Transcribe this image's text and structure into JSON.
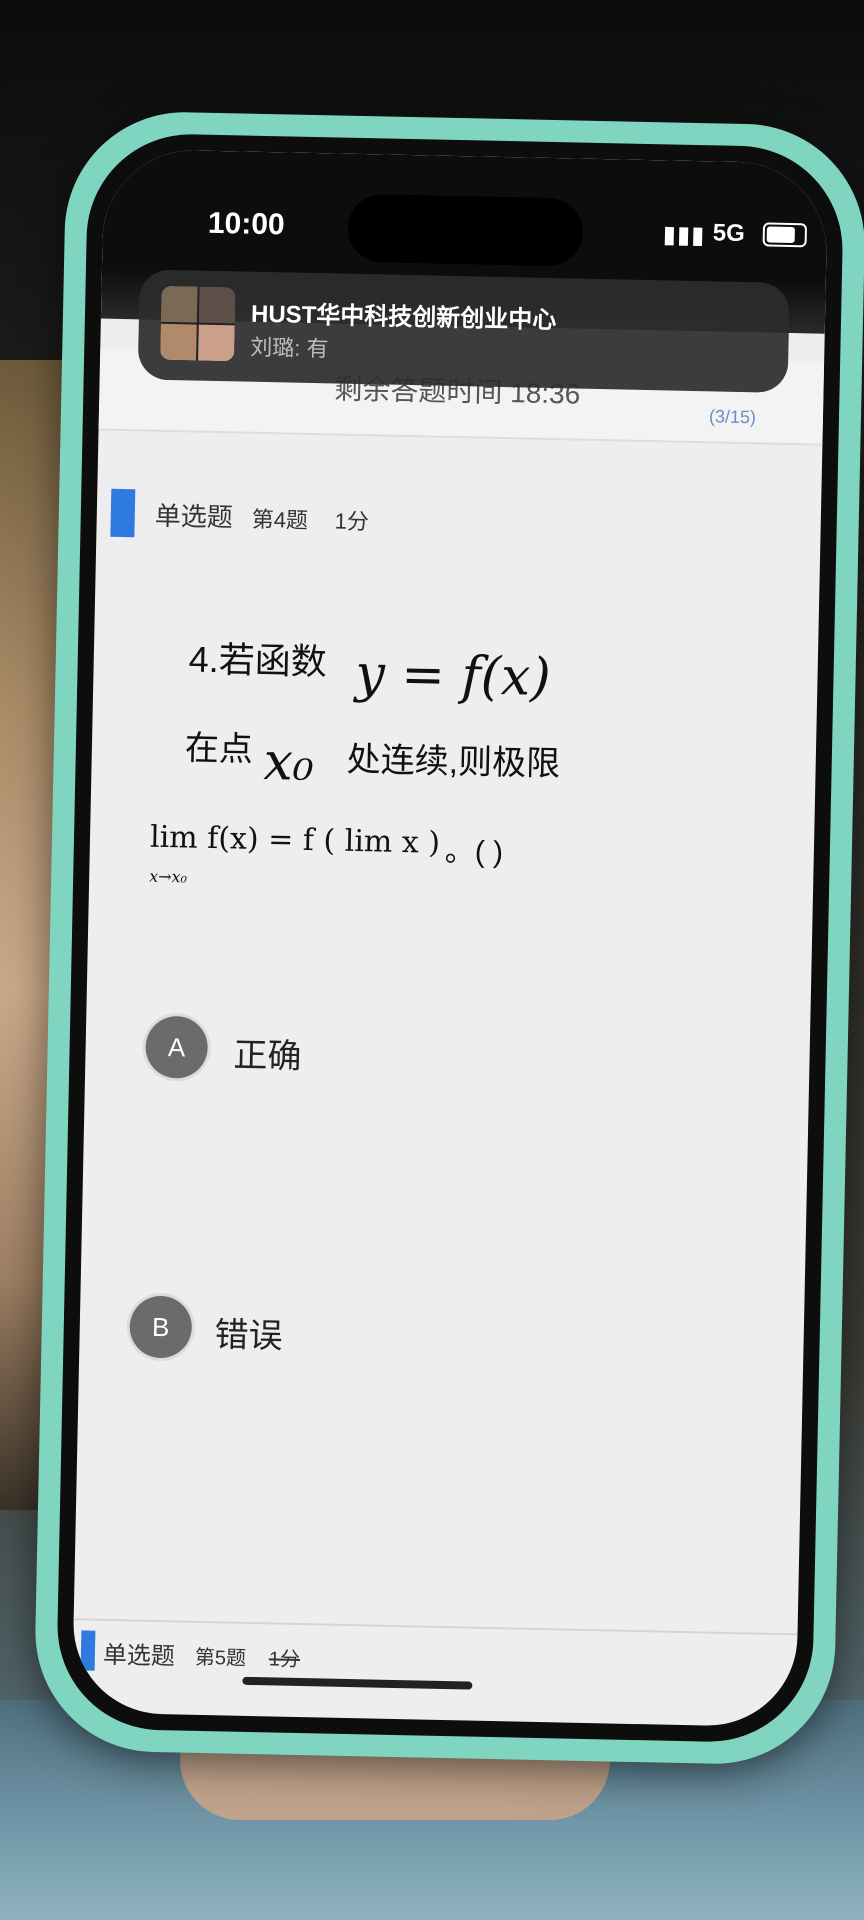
{
  "status_bar": {
    "time": "10:00",
    "network": "5G"
  },
  "notification": {
    "title": "HUST华中科技创新创业中心",
    "message": "刘璐: 有"
  },
  "exam": {
    "timer": "剩余答题时间 18:36",
    "progress": "(3/15)"
  },
  "question": {
    "type": "单选题",
    "number_label": "第4题",
    "score": "1分",
    "text_part1": "4.若函数",
    "math_y": "y = f(x)",
    "text_part2": "在点",
    "math_x0": "x₀",
    "text_part3": "处连续,则极限",
    "math_limit": "lim f(x) = f ( lim x )",
    "math_sub": "x→x₀",
    "bracket": "。( )"
  },
  "options": [
    {
      "letter": "A",
      "label": "正确"
    },
    {
      "letter": "B",
      "label": "错误"
    }
  ],
  "next_question": {
    "type": "单选题",
    "number_label": "第5题",
    "score": "1分"
  }
}
